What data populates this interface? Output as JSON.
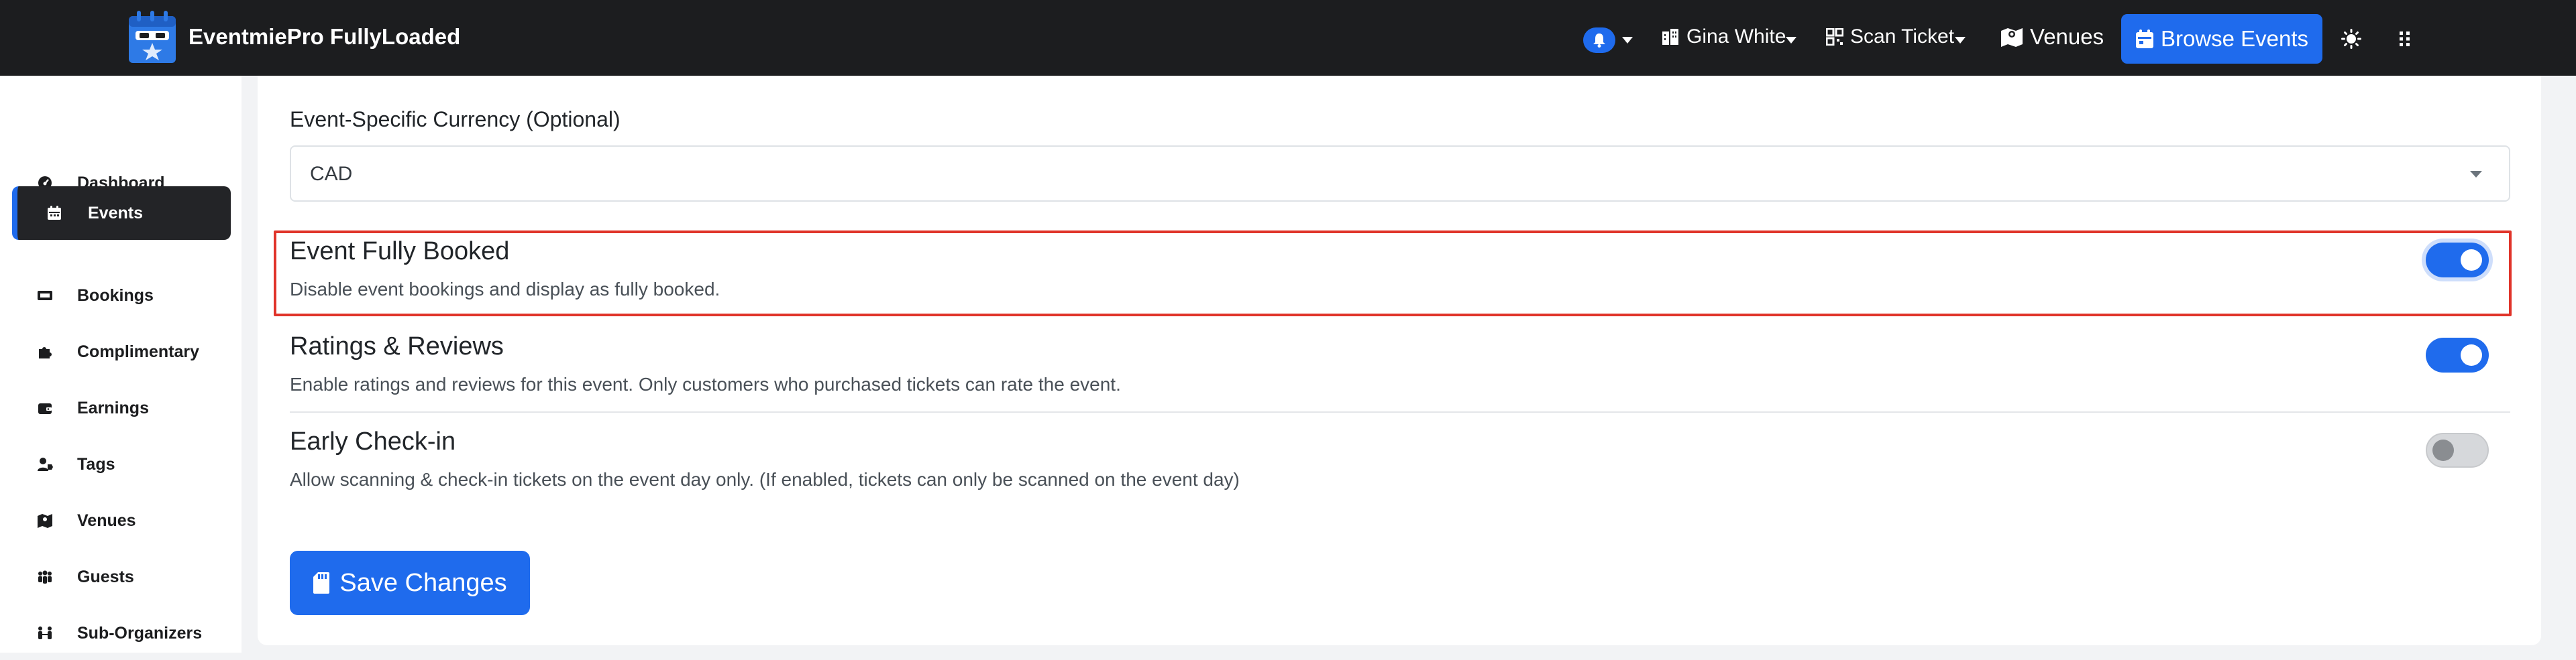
{
  "brand": {
    "name": "EventmiePro FullyLoaded",
    "logo_icon": "calendar-logo-icon"
  },
  "topnav": {
    "notifications_icon": "bell-icon",
    "user_name": "Gina White",
    "scan_ticket": "Scan Ticket",
    "venues": "Venues",
    "browse_events": "Browse Events",
    "theme_icon": "sun-icon",
    "apps_icon": "grid-icon"
  },
  "sidebar": {
    "items": [
      {
        "label": "Dashboard",
        "icon": "dashboard-icon",
        "active": false
      },
      {
        "label": "Events",
        "icon": "calendar-icon",
        "active": true
      },
      {
        "label": "Bookings",
        "icon": "ticket-icon",
        "active": false
      },
      {
        "label": "Complimentary",
        "icon": "puzzle-icon",
        "active": false
      },
      {
        "label": "Earnings",
        "icon": "wallet-icon",
        "active": false
      },
      {
        "label": "Tags",
        "icon": "user-tag-icon",
        "active": false
      },
      {
        "label": "Venues",
        "icon": "map-icon",
        "active": false
      },
      {
        "label": "Guests",
        "icon": "people-icon",
        "active": false
      },
      {
        "label": "Sub-Organizers",
        "icon": "people-arrows-icon",
        "active": false
      }
    ]
  },
  "form": {
    "currency_label": "Event-Specific Currency (Optional)",
    "currency_value": "CAD",
    "settings": [
      {
        "title": "Event Fully Booked",
        "description": "Disable event bookings and display as fully booked.",
        "enabled": true
      },
      {
        "title": "Ratings & Reviews",
        "description": "Enable ratings and reviews for this event. Only customers who purchased tickets can rate the event.",
        "enabled": true
      },
      {
        "title": "Early Check-in",
        "description": "Allow scanning & check-in tickets on the event day only. (If enabled, tickets can only be scanned on the event day)",
        "enabled": false
      }
    ],
    "save_label": "Save Changes"
  },
  "colors": {
    "accent": "#1f6bed",
    "topbar": "#1c1d1f",
    "highlight": "#e0342a"
  }
}
